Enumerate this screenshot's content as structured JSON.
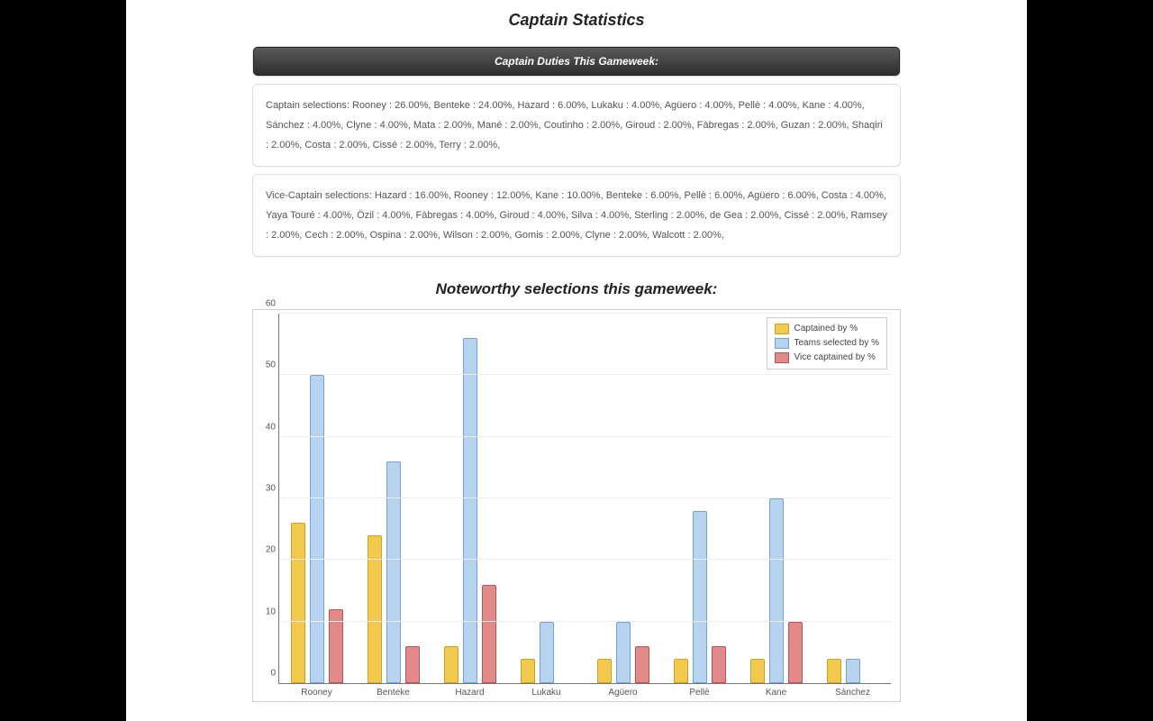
{
  "titles": {
    "main": "Captain Statistics",
    "panel_header": "Captain Duties This Gameweek:",
    "subtitle": "Noteworthy selections this gameweek:"
  },
  "captain_selections_text": "Captain selections: Rooney : 26.00%, Benteke : 24.00%, Hazard : 6.00%, Lukaku : 4.00%, Agüero : 4.00%, Pellè : 4.00%, Kane : 4.00%, Sánchez : 4.00%, Clyne : 4.00%, Mata : 2.00%, Mané : 2.00%, Coutinho : 2.00%, Giroud : 2.00%, Fàbregas : 2.00%, Guzan : 2.00%, Shaqiri : 2.00%, Costa : 2.00%, Cissé : 2.00%, Terry : 2.00%,",
  "vice_captain_selections_text": "Vice-Captain selections: Hazard : 16.00%, Rooney : 12.00%, Kane : 10.00%, Benteke : 6.00%, Pellè : 6.00%, Agüero : 6.00%, Costa : 4.00%, Yaya Touré : 4.00%, Özil : 4.00%, Fàbregas : 4.00%, Giroud : 4.00%, Silva : 4.00%, Sterling : 2.00%, de Gea : 2.00%, Cissé : 2.00%, Ramsey : 2.00%, Cech : 2.00%, Ospina : 2.00%, Wilson : 2.00%, Gomis : 2.00%, Clyne : 2.00%, Walcott : 2.00%,",
  "chart_data": {
    "type": "bar",
    "title": "",
    "xlabel": "",
    "ylabel": "",
    "ylim": [
      0,
      60
    ],
    "yticks": [
      0,
      10,
      20,
      30,
      40,
      50,
      60
    ],
    "categories": [
      "Rooney",
      "Benteke",
      "Hazard",
      "Lukaku",
      "Agüero",
      "Pellè",
      "Kane",
      "Sánchez"
    ],
    "series": [
      {
        "name": "Captained by %",
        "key": "captained",
        "values": [
          26,
          24,
          6,
          4,
          4,
          4,
          4,
          4
        ]
      },
      {
        "name": "Teams selected by %",
        "key": "teams",
        "values": [
          50,
          36,
          56,
          10,
          10,
          28,
          30,
          4
        ]
      },
      {
        "name": "Vice captained by %",
        "key": "vice",
        "values": [
          12,
          6,
          16,
          0,
          6,
          6,
          10,
          0
        ]
      }
    ],
    "legend_position": "top-right",
    "grid": true
  }
}
